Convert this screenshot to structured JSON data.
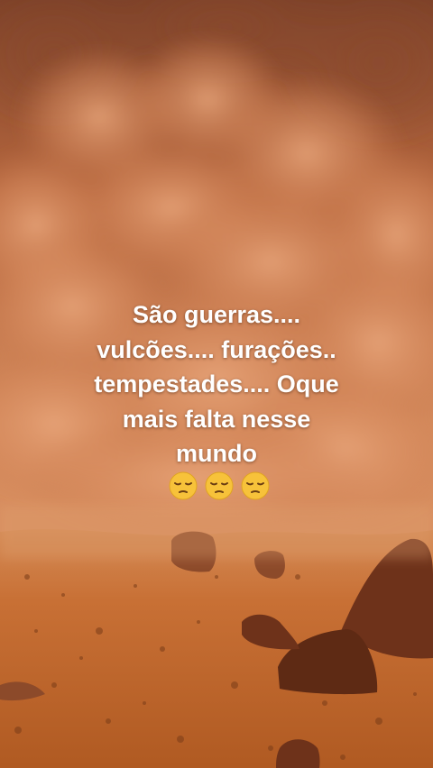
{
  "story": {
    "caption_lines": [
      "São guerras....",
      "vulcões.... furações..",
      "tempestades.... Oque",
      "mais falta nesse",
      "mundo"
    ],
    "emoji_count": 3,
    "emoji_name": "pensive-face-icon"
  },
  "colors": {
    "sky_top": "#8a4a2c",
    "dust": "#d98a5c",
    "ground": "#c06a2e",
    "text": "#ffffff"
  }
}
